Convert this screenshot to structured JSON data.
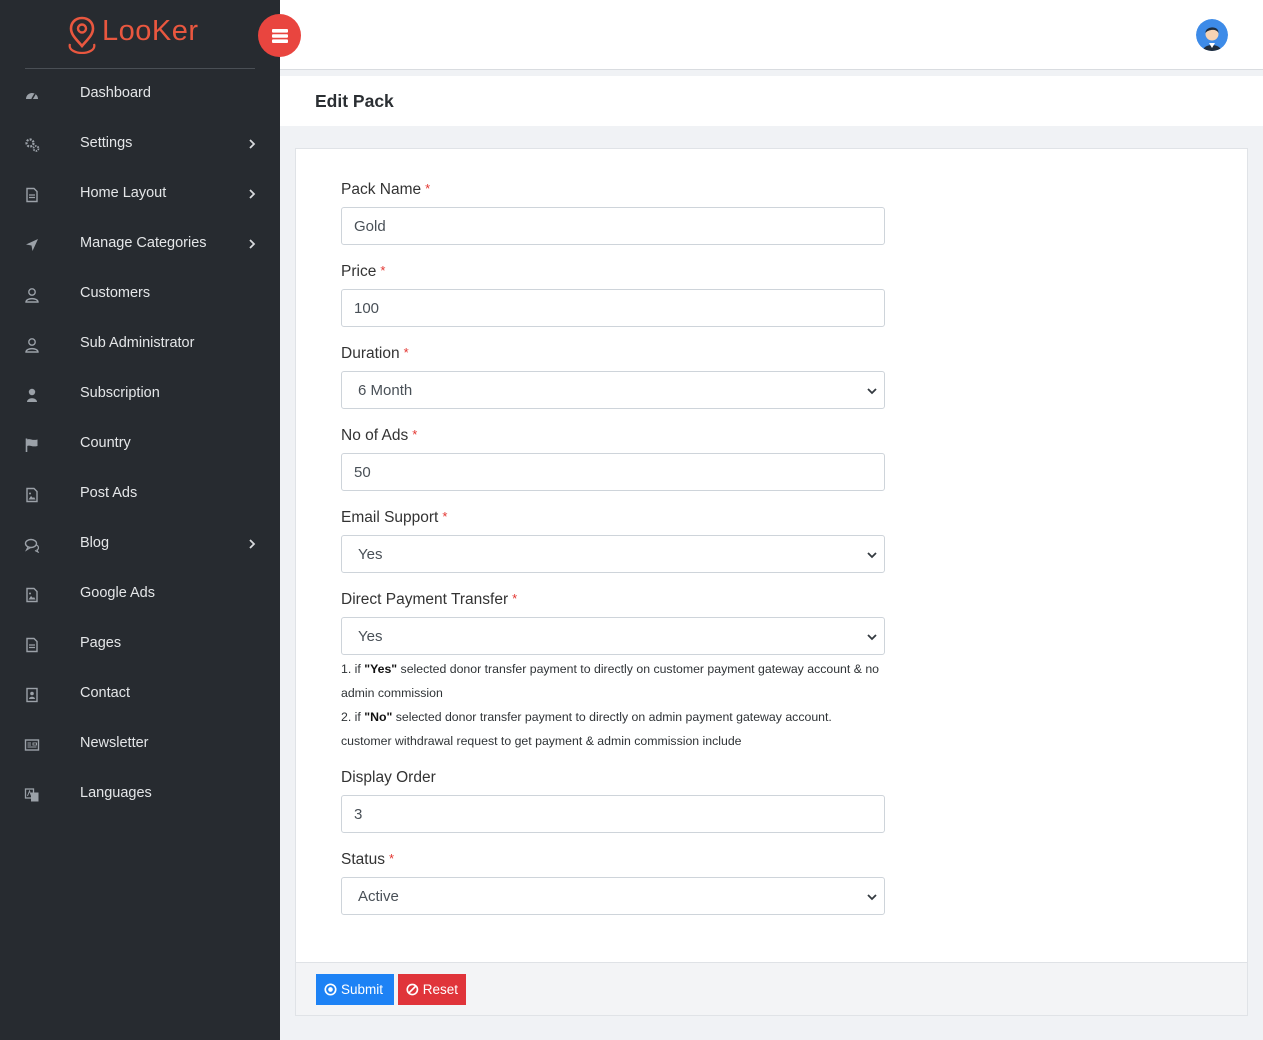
{
  "brand": {
    "name": "LooKer",
    "color": "#e9573f"
  },
  "sidebar": {
    "items": [
      {
        "label": "Dashboard",
        "icon": "dashboard-icon",
        "has_children": false
      },
      {
        "label": "Settings",
        "icon": "gears-icon",
        "has_children": true
      },
      {
        "label": "Home Layout",
        "icon": "document-icon",
        "has_children": true
      },
      {
        "label": "Manage Categories",
        "icon": "location-arrow-icon",
        "has_children": true
      },
      {
        "label": "Customers",
        "icon": "user-icon",
        "has_children": false
      },
      {
        "label": "Sub Administrator",
        "icon": "user-icon",
        "has_children": false
      },
      {
        "label": "Subscription",
        "icon": "user-solid-icon",
        "has_children": false
      },
      {
        "label": "Country",
        "icon": "flag-icon",
        "has_children": false
      },
      {
        "label": "Post Ads",
        "icon": "image-file-icon",
        "has_children": false
      },
      {
        "label": "Blog",
        "icon": "comments-icon",
        "has_children": true
      },
      {
        "label": "Google Ads",
        "icon": "image-file-icon",
        "has_children": false
      },
      {
        "label": "Pages",
        "icon": "document-icon",
        "has_children": false
      },
      {
        "label": "Contact",
        "icon": "contact-card-icon",
        "has_children": false
      },
      {
        "label": "Newsletter",
        "icon": "newspaper-icon",
        "has_children": false
      },
      {
        "label": "Languages",
        "icon": "language-icon",
        "has_children": false
      }
    ]
  },
  "header": {
    "toggle_icon": "menu-toggle-icon",
    "toggle_color": "#e9453f"
  },
  "page": {
    "title": "Edit Pack"
  },
  "form": {
    "pack_name": {
      "label": "Pack Name",
      "required": "*",
      "value": "Gold"
    },
    "price": {
      "label": "Price",
      "required": "*",
      "value": "100"
    },
    "duration": {
      "label": "Duration",
      "required": "*",
      "value": "6 Month"
    },
    "no_of_ads": {
      "label": "No of Ads",
      "required": "*",
      "value": "50"
    },
    "email_support": {
      "label": "Email Support",
      "required": "*",
      "value": "Yes"
    },
    "direct_payment": {
      "label": "Direct Payment Transfer",
      "required": "*",
      "value": "Yes"
    },
    "help": {
      "line1_prefix": "1. if ",
      "line1_bold": "\"Yes\"",
      "line1_text": " selected donor transfer payment to directly on customer payment gateway account & no admin commission",
      "line2_prefix": "2. if ",
      "line2_bold": "\"No\"",
      "line2_text": " selected donor transfer payment to directly on admin payment gateway account. customer withdrawal request to get payment & admin commission include"
    },
    "display_order": {
      "label": "Display Order",
      "value": "3"
    },
    "status": {
      "label": "Status",
      "required": "*",
      "value": "Active"
    }
  },
  "actions": {
    "submit": {
      "label": "Submit",
      "color": "#1d82f5"
    },
    "reset": {
      "label": "Reset",
      "color": "#e0343a"
    }
  }
}
